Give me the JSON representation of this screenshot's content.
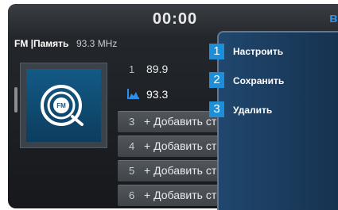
{
  "status": {
    "clock": "00:00",
    "bluetooth_icon": "bluetooth-icon"
  },
  "info": {
    "band": "FM",
    "separator": "|",
    "preset_label": "Память",
    "frequency": "93.3 MHz"
  },
  "art": {
    "logo_text": "FM",
    "icon": "fm-radio-icon"
  },
  "presets": [
    {
      "number": "1",
      "frequency": "89.9"
    },
    {
      "frequency": "93.3",
      "signal_icon": "signal-strength-icon"
    }
  ],
  "add_slots": [
    {
      "number": "3",
      "label": "+ Добавить ст"
    },
    {
      "number": "4",
      "label": "+ Добавить ст"
    },
    {
      "number": "5",
      "label": "+ Добавить ст"
    },
    {
      "number": "6",
      "label": "+ Добавить ст"
    }
  ],
  "menu": {
    "items": [
      {
        "label": "Настроить"
      },
      {
        "label": "Сохранить"
      },
      {
        "label": "Удалить"
      }
    ]
  },
  "callouts": [
    "1",
    "2",
    "3"
  ],
  "colors": {
    "accent": "#1d8fd8",
    "menu_bg": "#1b3b5c",
    "bluetooth": "#2f8fe6"
  }
}
